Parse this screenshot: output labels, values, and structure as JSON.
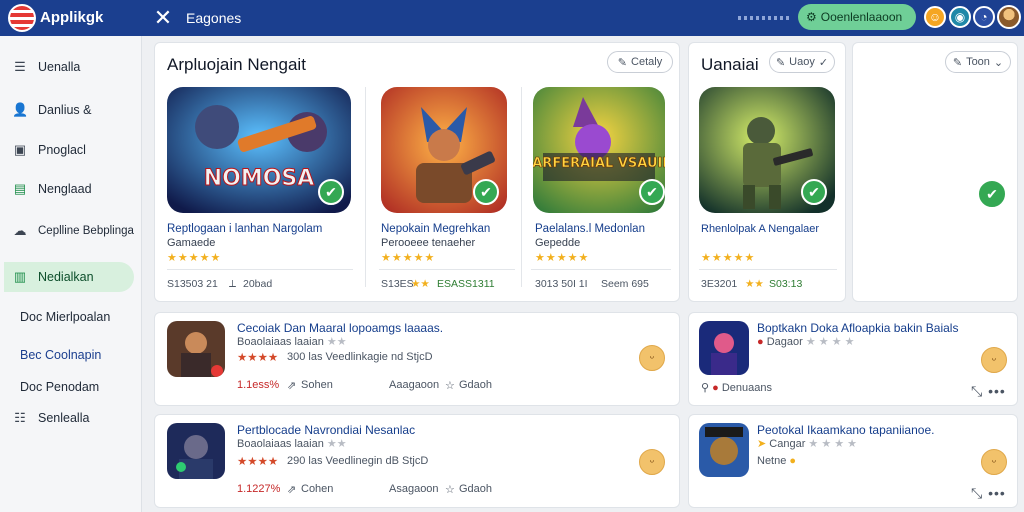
{
  "header": {
    "brand": "Applikgk",
    "page_tab": "Eagones",
    "action_label": "Ooenlenlaaoon",
    "action_icon": "gear-icon",
    "colors": {
      "bar": "#1b3f8f",
      "accent": "#6fcf97"
    }
  },
  "sidebar": {
    "items": [
      {
        "label": "Uenalla",
        "icon": "menu-icon"
      },
      {
        "label": "Danlius  &",
        "icon": "user-icon"
      },
      {
        "label": "Pnoglacl",
        "icon": "monitor-icon"
      },
      {
        "label": "Nenglaad",
        "icon": "chart-icon"
      },
      {
        "label": "Ceplline Bebplinga",
        "icon": "cloud-icon"
      },
      {
        "label": "Nedialkan",
        "icon": "bar-chart-icon",
        "active": true
      },
      {
        "label": "Doc Mierlpoalan",
        "icon": ""
      },
      {
        "label": "Bec Coolnapin",
        "icon": ""
      },
      {
        "label": "Doc Penodam",
        "icon": ""
      },
      {
        "label": "Senlealla",
        "icon": "list-icon"
      }
    ]
  },
  "featured": {
    "title": "Arpluojain Nengait",
    "button": "Cetaly",
    "apps": [
      {
        "art_text": "NOMOSA",
        "name": "Reptlogaan i lanhan Nargolam",
        "sub": "Gamaede",
        "rating": 5,
        "meta_left": "S13503 21",
        "meta_right": "20bad"
      },
      {
        "art_text": "",
        "name": "Nepokain Megrehkan",
        "sub": "Perooeee tenaeher",
        "rating": 5,
        "meta_left": "S13ES",
        "meta_right": "ESASS1311"
      },
      {
        "art_text": "DARFERAIAL VSAUIIS",
        "name": "Paelalans.l Medonlan",
        "sub": "Gepedde",
        "rating": 5,
        "meta_left": "3013 50I 1I",
        "meta_right": "Seem  695"
      }
    ]
  },
  "second": {
    "title": "Uanaiai",
    "button": "Uaoy",
    "app": {
      "name": "Rhenlolpak A Nengalaer",
      "rating": 5,
      "meta_left": "3E3201",
      "meta_right": "S03:13"
    }
  },
  "third": {
    "button": "Toon"
  },
  "list_left": [
    {
      "title": "Cecoiak Dan Maaral lopoamgs laaaas.",
      "sub": "Boaolaiaas laaian",
      "rating": 4,
      "line": "300 las Veedlinkagie nd StjcD",
      "num": "1.1ess%",
      "share": "Sohen",
      "cat": "Aaagaoon",
      "cat2": "Gdaoh"
    },
    {
      "title": "Pertblocade Navrondiai Nesanlac",
      "sub": "Boaolaiaas laaian",
      "rating": 4,
      "line": "290 las Veedlinegin dB StjcD",
      "num": "1.1227%",
      "share": "Cohen",
      "cat": "Asagaoon",
      "cat2": "Gdaoh"
    }
  ],
  "list_right": [
    {
      "title": "Boptkakn Doka Afloapkia bakin Baials",
      "sub": "Dagaor",
      "rating": 2,
      "meta": "Denuaans"
    },
    {
      "title": "Peotokal Ikaamkano tapaniianoe.",
      "sub": "Cangar",
      "rating": 2,
      "meta": "Netne"
    }
  ]
}
